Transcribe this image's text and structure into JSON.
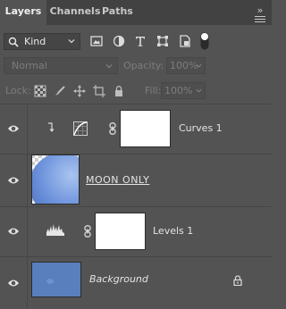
{
  "tabs": [
    {
      "label": "Layers",
      "active": true
    },
    {
      "label": "Channels",
      "active": false
    },
    {
      "label": "Paths",
      "active": false
    }
  ],
  "filter": {
    "kind_label": "Kind",
    "icons": [
      "image-filter-icon",
      "adjustment-filter-icon",
      "type-filter-icon",
      "shape-filter-icon",
      "smart-object-filter-icon",
      "filter-toggle"
    ]
  },
  "blend": {
    "mode": "Normal",
    "opacity_label": "Opacity:",
    "opacity_value": "100%"
  },
  "lock": {
    "label": "Lock:",
    "fill_label": "Fill:",
    "fill_value": "100%",
    "icons": [
      "lock-transparent-pixels-icon",
      "lock-image-pixels-icon",
      "lock-position-icon",
      "lock-artboard-icon",
      "lock-all-icon"
    ]
  },
  "layers": [
    {
      "name": "Curves 1",
      "type": "curves-adjustment",
      "visible": true,
      "clipped": true
    },
    {
      "name": "MOON ONLY",
      "type": "pixel",
      "visible": true
    },
    {
      "name": "Levels 1",
      "type": "levels-adjustment",
      "visible": true
    },
    {
      "name": "Background",
      "type": "background",
      "visible": true,
      "locked": true
    }
  ],
  "colors": {
    "panel_bg": "#535353",
    "tabbar_bg": "#424242",
    "background_fill": "#5a7fbd",
    "moon_fill": "#7aa2e6"
  }
}
